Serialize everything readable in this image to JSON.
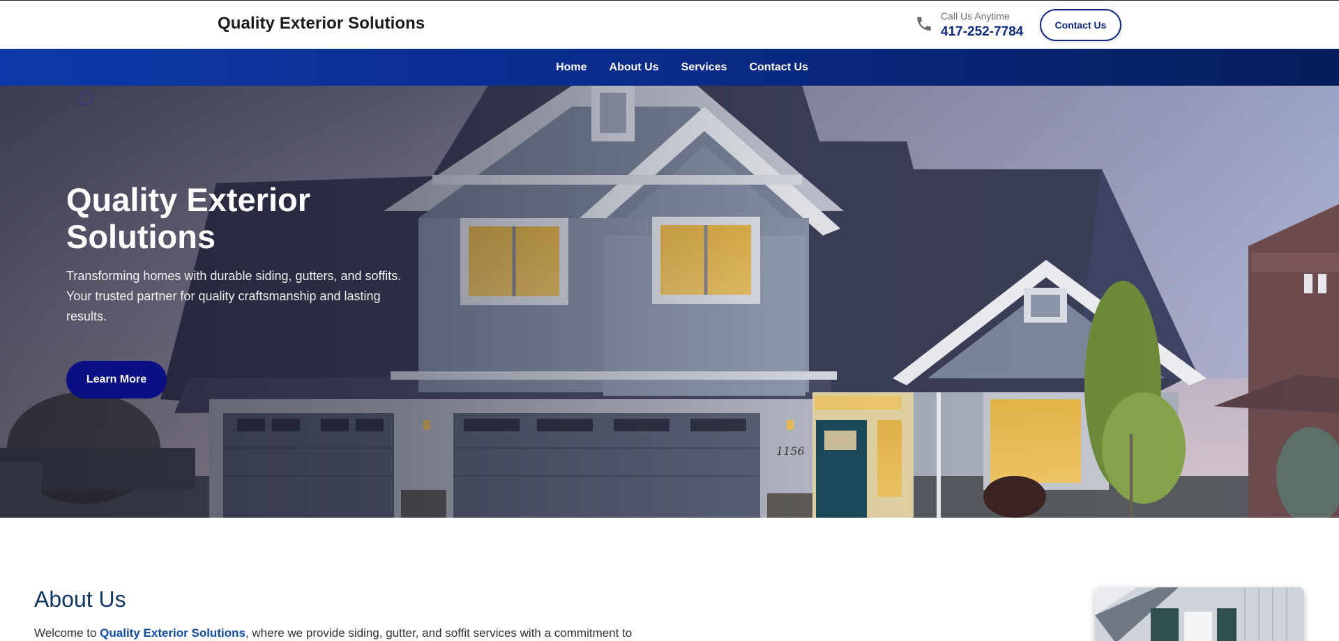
{
  "header": {
    "brand": "Quality Exterior Solutions",
    "call_label": "Call Us Anytime",
    "call_number": "417-252-7784",
    "contact_button": "Contact Us"
  },
  "nav": {
    "items": [
      {
        "label": "Home"
      },
      {
        "label": "About Us"
      },
      {
        "label": "Services"
      },
      {
        "label": "Contact Us"
      }
    ]
  },
  "hero": {
    "title": "Quality Exterior Solutions",
    "description": "Transforming homes with durable siding, gutters, and soffits. Your trusted partner for quality craftsmanship and lasting results.",
    "button": "Learn More",
    "house_number": "1156"
  },
  "about": {
    "heading": "About Us",
    "text_before": "Welcome to ",
    "text_highlight": "Quality Exterior Solutions",
    "text_after": ", where we provide siding, gutter, and soffit services with a commitment to"
  },
  "colors": {
    "brand_blue": "#0e2a83",
    "nav_gradient_start": "#0d3aa8",
    "nav_gradient_end": "#071d5c",
    "hero_button": "#0a0f85",
    "about_heading": "#0f3563"
  },
  "icons": {
    "phone": "phone-icon",
    "ring": "ring-icon"
  }
}
